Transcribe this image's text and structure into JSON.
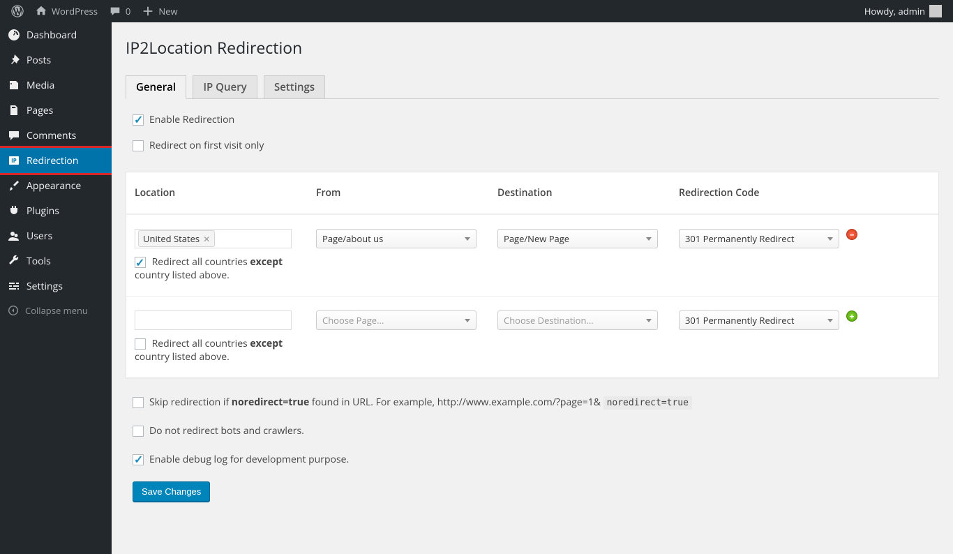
{
  "adminbar": {
    "site_name": "WordPress",
    "comments_count": "0",
    "new_label": "New",
    "howdy": "Howdy, admin"
  },
  "sidebar": {
    "dashboard": "Dashboard",
    "posts": "Posts",
    "media": "Media",
    "pages": "Pages",
    "comments": "Comments",
    "redirection": "Redirection",
    "appearance": "Appearance",
    "plugins": "Plugins",
    "users": "Users",
    "tools": "Tools",
    "settings": "Settings",
    "collapse": "Collapse menu"
  },
  "page": {
    "title": "IP2Location Redirection"
  },
  "tabs": {
    "general": "General",
    "ipquery": "IP Query",
    "settings": "Settings"
  },
  "options": {
    "enable_redirection": "Enable Redirection",
    "first_visit": "Redirect on first visit only",
    "skip_noredirect_prefix": "Skip redirection if ",
    "skip_noredirect_bold": "noredirect=true",
    "skip_noredirect_suffix": " found in URL. For example, http://www.example.com/?page=1& ",
    "skip_noredirect_code": "noredirect=true",
    "no_bots": "Do not redirect bots and crawlers.",
    "debug_log": "Enable debug log for development purpose."
  },
  "table": {
    "col_location": "Location",
    "col_from": "From",
    "col_destination": "Destination",
    "col_code": "Redirection Code",
    "except_prefix": "Redirect all countries ",
    "except_bold": "except",
    "except_suffix": " country listed above.",
    "rows": [
      {
        "location_tag": "United States",
        "from": "Page/about us",
        "dest": "Page/New Page",
        "code": "301 Permanently Redirect",
        "except_checked": true,
        "action": "remove"
      },
      {
        "location_tag": "",
        "from": "Choose Page...",
        "dest": "Choose Destination...",
        "code": "301 Permanently Redirect",
        "except_checked": false,
        "action": "add",
        "placeholder": true
      }
    ]
  },
  "buttons": {
    "save": "Save Changes"
  }
}
